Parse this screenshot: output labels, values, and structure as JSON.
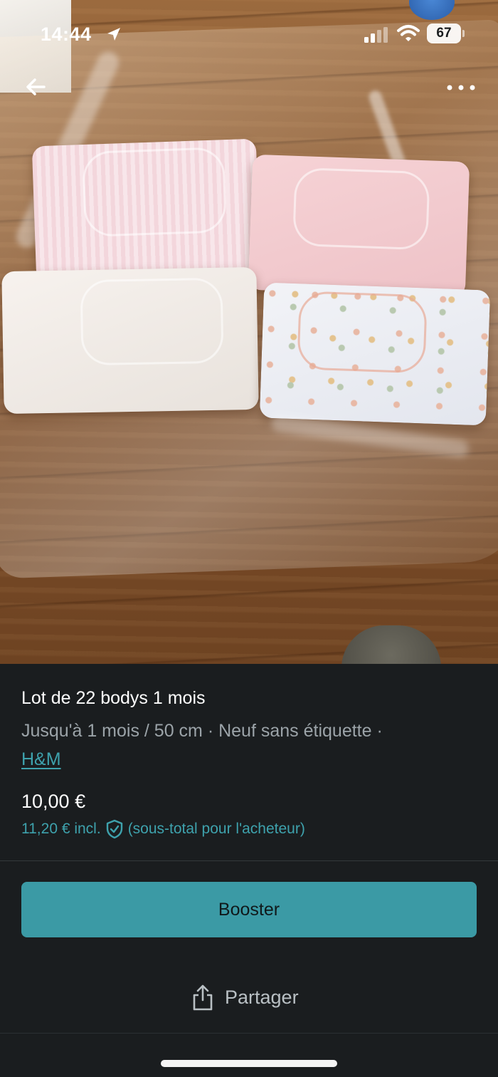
{
  "status_bar": {
    "time": "14:44",
    "battery": "67",
    "icons": [
      "location-arrow-icon",
      "signal-icon",
      "wifi-icon",
      "battery-icon"
    ]
  },
  "nav": {
    "back_icon": "arrow-left-icon",
    "more_icon": "more-horizontal-icon"
  },
  "listing": {
    "title": "Lot de 22 bodys 1 mois",
    "meta_prefix": "Jusqu'à 1 mois / 50 cm · Neuf sans étiquette ·",
    "brand": "H&M",
    "price": "10,00 €",
    "price_incl": "11,20 € incl.",
    "price_incl_note": "(sous-total pour l'acheteur)"
  },
  "actions": {
    "boost_label": "Booster",
    "share_label": "Partager"
  },
  "colors": {
    "accent": "#3ea2ad",
    "button": "#3b9aa5",
    "background": "#1a1d1f"
  }
}
